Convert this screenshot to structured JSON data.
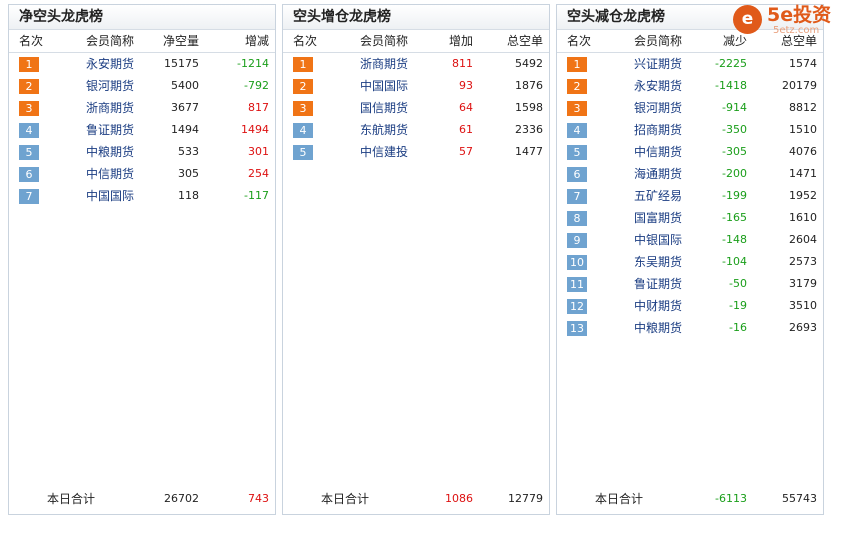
{
  "panels": [
    {
      "title": "净空头龙虎榜",
      "headers": [
        "名次",
        "会员简称",
        "净空量",
        "增减"
      ],
      "rows": [
        {
          "rank": "1",
          "name": "永安期货",
          "v1": "15175",
          "v2": "-1214",
          "v2_color": "green"
        },
        {
          "rank": "2",
          "name": "银河期货",
          "v1": "5400",
          "v2": "-792",
          "v2_color": "green"
        },
        {
          "rank": "3",
          "name": "浙商期货",
          "v1": "3677",
          "v2": "817",
          "v2_color": "red"
        },
        {
          "rank": "4",
          "name": "鲁证期货",
          "v1": "1494",
          "v2": "1494",
          "v2_color": "red"
        },
        {
          "rank": "5",
          "name": "中粮期货",
          "v1": "533",
          "v2": "301",
          "v2_color": "red"
        },
        {
          "rank": "6",
          "name": "中信期货",
          "v1": "305",
          "v2": "254",
          "v2_color": "red"
        },
        {
          "rank": "7",
          "name": "中国国际",
          "v1": "118",
          "v2": "-117",
          "v2_color": "green"
        }
      ],
      "total": {
        "label": "本日合计",
        "v1": "26702",
        "v2": "743"
      }
    },
    {
      "title": "空头增仓龙虎榜",
      "headers": [
        "名次",
        "会员简称",
        "增加",
        "总空单"
      ],
      "rows": [
        {
          "rank": "1",
          "name": "浙商期货",
          "v1": "811",
          "v2": "5492"
        },
        {
          "rank": "2",
          "name": "中国国际",
          "v1": "93",
          "v2": "1876"
        },
        {
          "rank": "3",
          "name": "国信期货",
          "v1": "64",
          "v2": "1598"
        },
        {
          "rank": "4",
          "name": "东航期货",
          "v1": "61",
          "v2": "2336"
        },
        {
          "rank": "5",
          "name": "中信建投",
          "v1": "57",
          "v2": "1477"
        }
      ],
      "total": {
        "label": "本日合计",
        "v1": "1086",
        "v2": "12779"
      }
    },
    {
      "title": "空头减仓龙虎榜",
      "headers": [
        "名次",
        "会员简称",
        "减少",
        "总空单"
      ],
      "rows": [
        {
          "rank": "1",
          "name": "兴证期货",
          "v1": "-2225",
          "v2": "1574"
        },
        {
          "rank": "2",
          "name": "永安期货",
          "v1": "-1418",
          "v2": "20179"
        },
        {
          "rank": "3",
          "name": "银河期货",
          "v1": "-914",
          "v2": "8812"
        },
        {
          "rank": "4",
          "name": "招商期货",
          "v1": "-350",
          "v2": "1510"
        },
        {
          "rank": "5",
          "name": "中信期货",
          "v1": "-305",
          "v2": "4076"
        },
        {
          "rank": "6",
          "name": "海通期货",
          "v1": "-200",
          "v2": "1471"
        },
        {
          "rank": "7",
          "name": "五矿经易",
          "v1": "-199",
          "v2": "1952"
        },
        {
          "rank": "8",
          "name": "国富期货",
          "v1": "-165",
          "v2": "1610"
        },
        {
          "rank": "9",
          "name": "中银国际",
          "v1": "-148",
          "v2": "2604"
        },
        {
          "rank": "10",
          "name": "东吴期货",
          "v1": "-104",
          "v2": "2573"
        },
        {
          "rank": "11",
          "name": "鲁证期货",
          "v1": "-50",
          "v2": "3179"
        },
        {
          "rank": "12",
          "name": "中财期货",
          "v1": "-19",
          "v2": "3510"
        },
        {
          "rank": "13",
          "name": "中粮期货",
          "v1": "-16",
          "v2": "2693"
        }
      ],
      "total": {
        "label": "本日合计",
        "v1": "-6113",
        "v2": "55743"
      }
    }
  ],
  "logo": {
    "brand": "5e投资",
    "domain": "5etz.com",
    "icon": "5e-logo-icon"
  },
  "colors": {
    "rank_top": "#f07416",
    "rank_rest": "#6fa3d0",
    "positive": "#d11111",
    "negative": "#1a9e1a",
    "name": "#1b3d82"
  }
}
